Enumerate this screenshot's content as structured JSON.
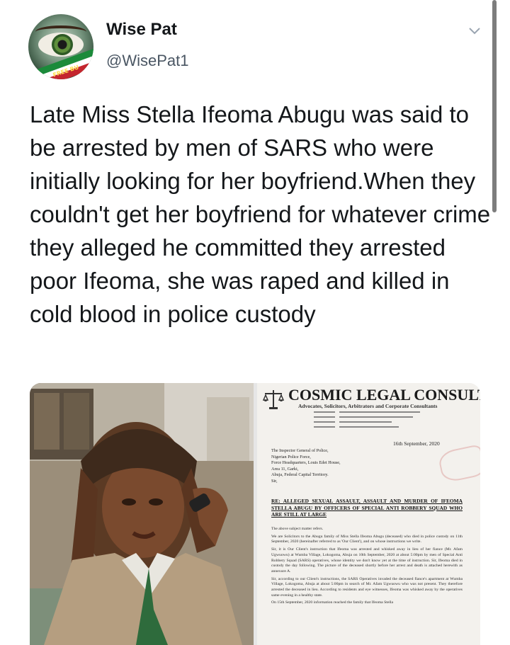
{
  "author": {
    "name": "Wise Pat",
    "handle": "@WisePat1",
    "avatar_badge_text": "FREE BU"
  },
  "tweet": {
    "text": "Late Miss Stella Ifeoma Abugu was said to be arrested by men of SARS who were initially looking for her boyfriend.When they couldn't get her boyfriend for whatever crime they alleged he committed they arrested poor Ifeoma, she was raped and killed in cold blood in police custody"
  },
  "icons": {
    "menu": "chevron-down-icon",
    "scales": "scales-of-justice-icon"
  },
  "document": {
    "firm_name": "COSMIC LEGAL CONSULT",
    "firm_subtitle": "Advocates, Solicitors, Arbitrators and Corporate Consultants",
    "date": "16th September, 2020",
    "addressee": "The Inspector General of Police,\nNigerian Police Force,\nForce Headquarters, Louis Edet House,\nArea 11, Garki,\nAbuja, Federal Capital Territory.\nSir,",
    "subject": "RE: ALLEGED SEXUAL ASSAULT, ASSAULT AND MURDER OF IFEOMA STELLA ABUGU BY OFFICERS OF SPECIAL ANTI ROBBERY SQUAD WHO ARE STILL AT LARGE",
    "para1": "The above subject matter refers.",
    "para2": "We are Solicitors to the Abugu family of Miss Stella Ifeoma Abugu (deceased) who died in police custody on 11th September, 2020 (hereinafter referred to as 'Our Client'), and on whose instructions we write.",
    "para3": "Sir, it is Our Client's instruction that Ifeoma was arrested and whisked away in lieu of her fiance (Mr. Afam Ugwuowu) at Wumba Village, Lokogoma, Abuja on 10th September, 2020 at about 5:00pm by men of Special Anti Robbery Squad (SARS) operatives, whose identity we don't know yet at the time of instruction. Sir, Ifeoma died in custody the day following. The picture of the deceased shortly before her arrest and death is attached herewith as annexure A.",
    "para4": "Sir, according to our Client's instructions, the SARS Operatives invaded the deceased fiance's apartment at Wumba Village, Lokogoma, Abuja at about 5:00pm in search of Mr. Afam Ugwuowu who was not present. They therefore arrested the deceased in lieu. According to residents and eye witnesses, Ifeoma was whisked away by the operatives same evening in a healthy state.",
    "para5": "On 15th September, 2020 information reached the family that Ifeoma Stella"
  },
  "colors": {
    "text_primary": "#14171a",
    "text_secondary": "#4a5663",
    "nigeria_green": "#1b8a3a",
    "nigeria_red": "#c4262e"
  }
}
